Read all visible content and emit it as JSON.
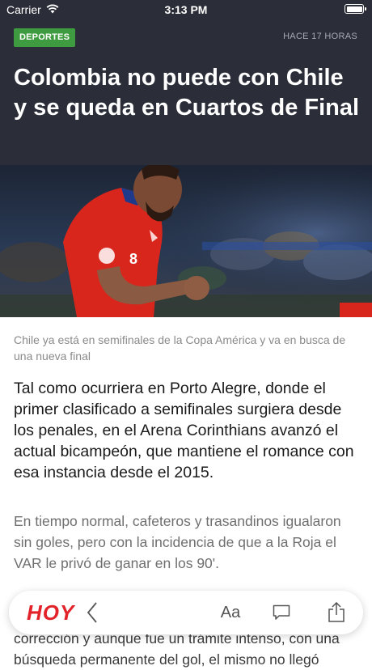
{
  "status": {
    "carrier": "Carrier",
    "time": "3:13 PM"
  },
  "article": {
    "category": "DEPORTES",
    "timestamp": "HACE 17 HORAS",
    "title": "Colombia no puede con Chile y se queda en Cuartos de Final",
    "caption": "Chile ya está en semifinales de la Copa América y va en busca de una nueva final",
    "lead": "Tal como ocurriera en Porto Alegre, donde el primer clasificado a semifinales surgiera desde los penales, en el Arena Corinthians avanzó el actual bicampeón, que mantiene el romance con esa instancia desde el 2015.",
    "paragraph_1": "En tiempo normal, cafeteros y trasandinos igualaron sin goles, pero con la incidencia de que a la Roja el VAR le privó de ganar en los 90'.",
    "paragraph_2_partial": "corrección y aunque fue un trámite intenso, con una búsqueda permanente del gol, el mismo no llegó"
  },
  "toolbar": {
    "logo": "HOY",
    "font_size_label": "Aa",
    "icons": [
      "chevron-left-icon",
      "comment-icon",
      "share-icon"
    ]
  },
  "colors": {
    "header_bg": "#2b2e38",
    "category_badge": "#3f9b3f",
    "logo": "#e3232a"
  }
}
